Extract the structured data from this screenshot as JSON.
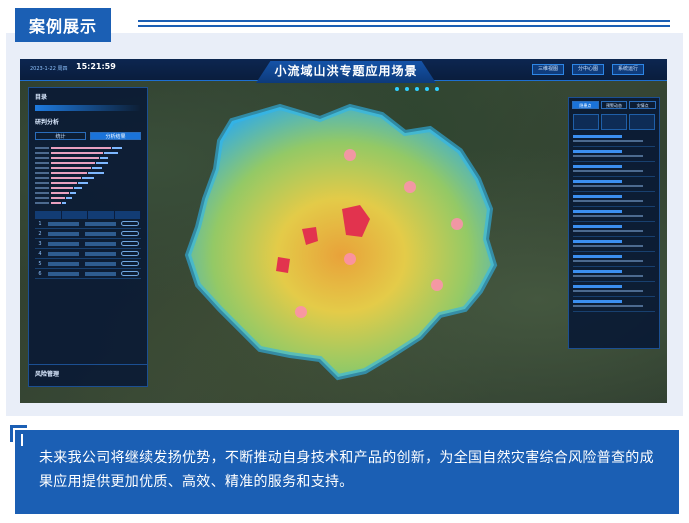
{
  "header": {
    "tab_label": "案例展示"
  },
  "app": {
    "title": "小流域山洪专题应用场景",
    "date": "2023-1-22 周四",
    "time": "15:21:59",
    "top_buttons": [
      "三维视图",
      "分中心图",
      "系统运行"
    ]
  },
  "left_panel": {
    "title": "目录",
    "section": "研判分析",
    "tabs": [
      "统计",
      "分析结果"
    ]
  },
  "left_bottom": {
    "title": "风险管理"
  },
  "right_panel": {
    "tabs": [
      "隐患点",
      "预警动态",
      "灾情点"
    ]
  },
  "description": "未来我公司将继续发扬优势，不断推动自身技术和产品的创新，为全国自然灾害综合风险普查的成果应用提供更加优质、高效、精准的服务和支持。",
  "colors": {
    "brand_blue": "#1b5fb4",
    "panel_bg": "#e9eef8",
    "app_dark": "#0a1a33"
  }
}
